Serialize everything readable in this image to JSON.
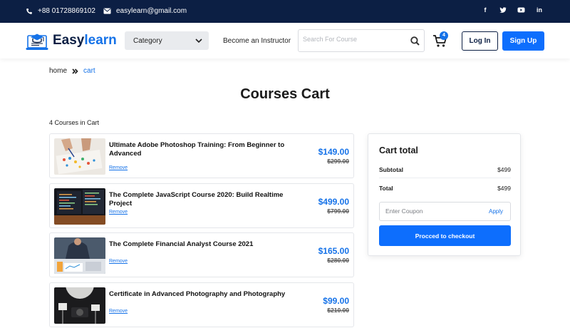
{
  "topbar": {
    "phone": "+88 01728869102",
    "email": "easylearn@gmail.com",
    "social": [
      "f",
      "t",
      "yt",
      "in"
    ]
  },
  "header": {
    "brand_part1": "Easy",
    "brand_part2": "learn",
    "category_label": "Category",
    "instructor_link": "Become an Instructor",
    "search_placeholder": "Search For Course",
    "cart_count": "4",
    "login_label": "Log In",
    "signup_label": "Sign Up"
  },
  "breadcrumb": {
    "home": "home",
    "current": "cart"
  },
  "page": {
    "title": "Courses Cart",
    "course_count": "4 Courses in Cart"
  },
  "courses": [
    {
      "title": "Ultimate Adobe Photoshop Training: From Beginner to Advanced",
      "remove": "Remove",
      "price": "$149.00",
      "old_price": "$299.00"
    },
    {
      "title": "The Complete JavaScript Course 2020: Build Realtime Project",
      "remove": "Remove",
      "price": "$499.00",
      "old_price": "$799.00"
    },
    {
      "title": "The Complete Financial Analyst Course 2021",
      "remove": "Remove",
      "price": "$165.00",
      "old_price": "$280.00"
    },
    {
      "title": "Certificate in Advanced Photography and Photography",
      "remove": "Remove",
      "price": "$99.00",
      "old_price": "$210.00"
    }
  ],
  "summary": {
    "title": "Cart total",
    "subtotal_label": "Subtotal",
    "subtotal_value": "$499",
    "total_label": "Total",
    "total_value": "$499",
    "coupon_placeholder": "Enter Coupon",
    "apply_label": "Apply",
    "checkout_label": "Procced to checkout"
  },
  "colors": {
    "navy": "#0c1f44",
    "accent": "#1572e8",
    "button": "#0d6efd"
  }
}
